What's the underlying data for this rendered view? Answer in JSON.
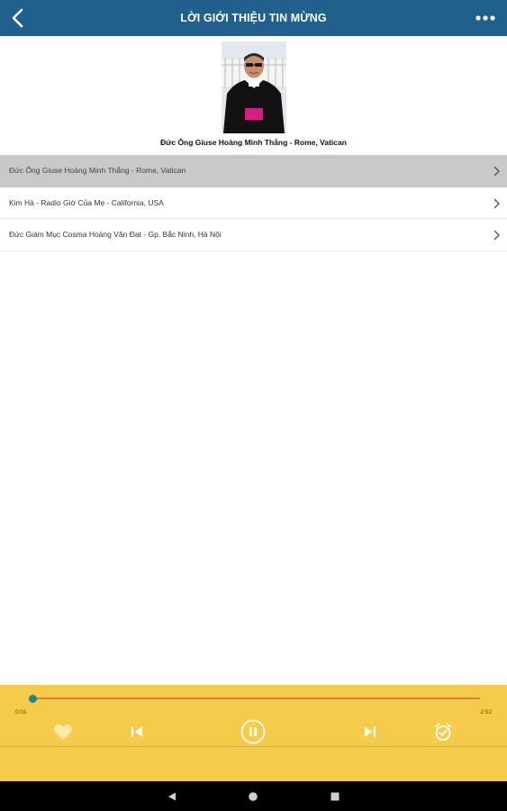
{
  "header": {
    "title": "LỜI GIỚI THIỆU TIN MỪNG",
    "back_icon": "chevron-left-icon",
    "menu_icon": "more-horizontal-icon"
  },
  "featured": {
    "caption": "Đức Ông Giuse Hoàng Minh Thắng - Rome, Vatican"
  },
  "list": {
    "items": [
      {
        "label": "Đức Ông Giuse Hoàng Minh Thắng - Rome, Vatican",
        "selected": true
      },
      {
        "label": "Kim Hà - Radio Giờ Của Mẹ - California, USA",
        "selected": false
      },
      {
        "label": "Đức Giám Mục Cosma Hoàng Văn Đạt - Gp. Bắc Ninh, Hà Nội",
        "selected": false
      }
    ]
  },
  "player": {
    "current_time": "0:01",
    "total_time": "2:52",
    "progress": 0.006,
    "controls": [
      "heart-icon",
      "skip-previous-icon",
      "pause-icon",
      "skip-next-icon",
      "alarm-check-icon"
    ],
    "colors": {
      "background": "#f5cb4a",
      "track": "#e37a3a",
      "thumb": "#148a8a"
    }
  },
  "system_nav": {
    "buttons": [
      "back-triangle-icon",
      "home-circle-icon",
      "recents-square-icon"
    ]
  },
  "colors": {
    "header_bg": "#215f8c",
    "selected_row_bg": "#c9c9c9"
  }
}
